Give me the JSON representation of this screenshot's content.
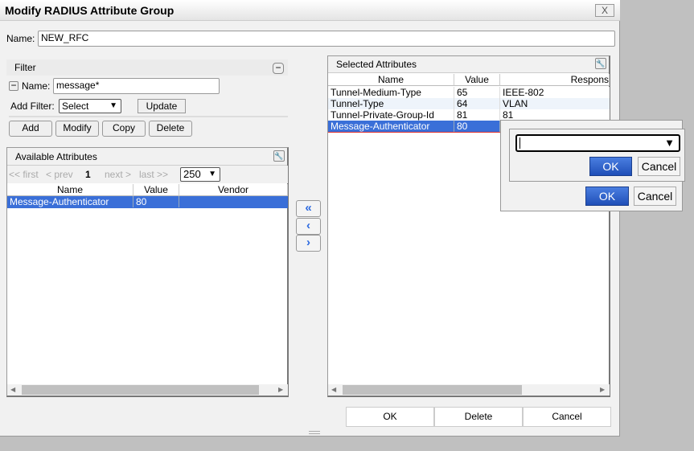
{
  "title": "Modify RADIUS Attribute Group",
  "close_label": "X",
  "name_label": "Name:",
  "name_value": "NEW_RFC",
  "filter": {
    "title": "Filter",
    "name_label": "Name:",
    "name_value": "message*",
    "add_filter_label": "Add Filter:",
    "add_filter_value": "Select",
    "update": "Update"
  },
  "actions": {
    "add": "Add",
    "modify": "Modify",
    "copy": "Copy",
    "delete": "Delete"
  },
  "available": {
    "title": "Available Attributes",
    "pager": {
      "first": "<< first",
      "prev": "< prev",
      "page": "1",
      "next": "next >",
      "last": "last >>",
      "page_size": "250"
    },
    "columns": [
      "Name",
      "Value",
      "Vendor"
    ],
    "rows": [
      [
        "Message-Authenticator",
        "80",
        ""
      ]
    ]
  },
  "selected": {
    "title": "Selected Attributes",
    "columns": [
      "Name",
      "Value",
      "Respons"
    ],
    "rows": [
      [
        "Tunnel-Medium-Type",
        "65",
        "IEEE-802"
      ],
      [
        "Tunnel-Type",
        "64",
        "VLAN"
      ],
      [
        "Tunnel-Private-Group-Id",
        "81",
        "81"
      ],
      [
        "Message-Authenticator",
        "80",
        ""
      ]
    ]
  },
  "popup": {
    "dropdown_value": "",
    "ok": "OK",
    "cancel": "Cancel",
    "outer_ok": "OK",
    "outer_cancel": "Cancel"
  },
  "footer": {
    "ok": "OK",
    "delete": "Delete",
    "cancel": "Cancel"
  },
  "colors": {
    "selection": "#3a6fd8",
    "ok_button": "#2f5fcc"
  }
}
